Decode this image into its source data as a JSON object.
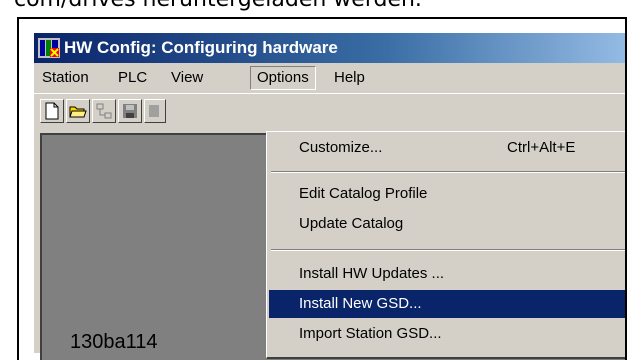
{
  "page": {
    "top_text": "com/drives heruntergeladen werden."
  },
  "window": {
    "title": "HW Config: Configuring hardware",
    "menubar": [
      {
        "label": "Station"
      },
      {
        "label": "PLC"
      },
      {
        "label": "View"
      },
      {
        "label": "Options",
        "open": true
      },
      {
        "label": "Help"
      }
    ]
  },
  "toolbar": {
    "buttons": [
      {
        "icon": "new-document-icon"
      },
      {
        "icon": "open-folder-icon"
      },
      {
        "icon": "network-icon"
      },
      {
        "icon": "save-icon"
      },
      {
        "icon": "download-icon"
      }
    ]
  },
  "options_menu": {
    "items": [
      {
        "label": "Customize...",
        "shortcut": "Ctrl+Alt+E"
      },
      {
        "label": "Edit Catalog Profile"
      },
      {
        "label": "Update Catalog"
      },
      {
        "label": "Install HW Updates ..."
      },
      {
        "label": "Install New GSD...",
        "highlighted": true
      },
      {
        "label": "Import Station GSD..."
      }
    ]
  },
  "caption": "130ba114",
  "colors": {
    "titlebar_start": "#0a246a",
    "titlebar_end": "#a6caf0",
    "highlight": "#0a246a",
    "chrome": "#d4d0c8",
    "workspace": "#808080"
  }
}
